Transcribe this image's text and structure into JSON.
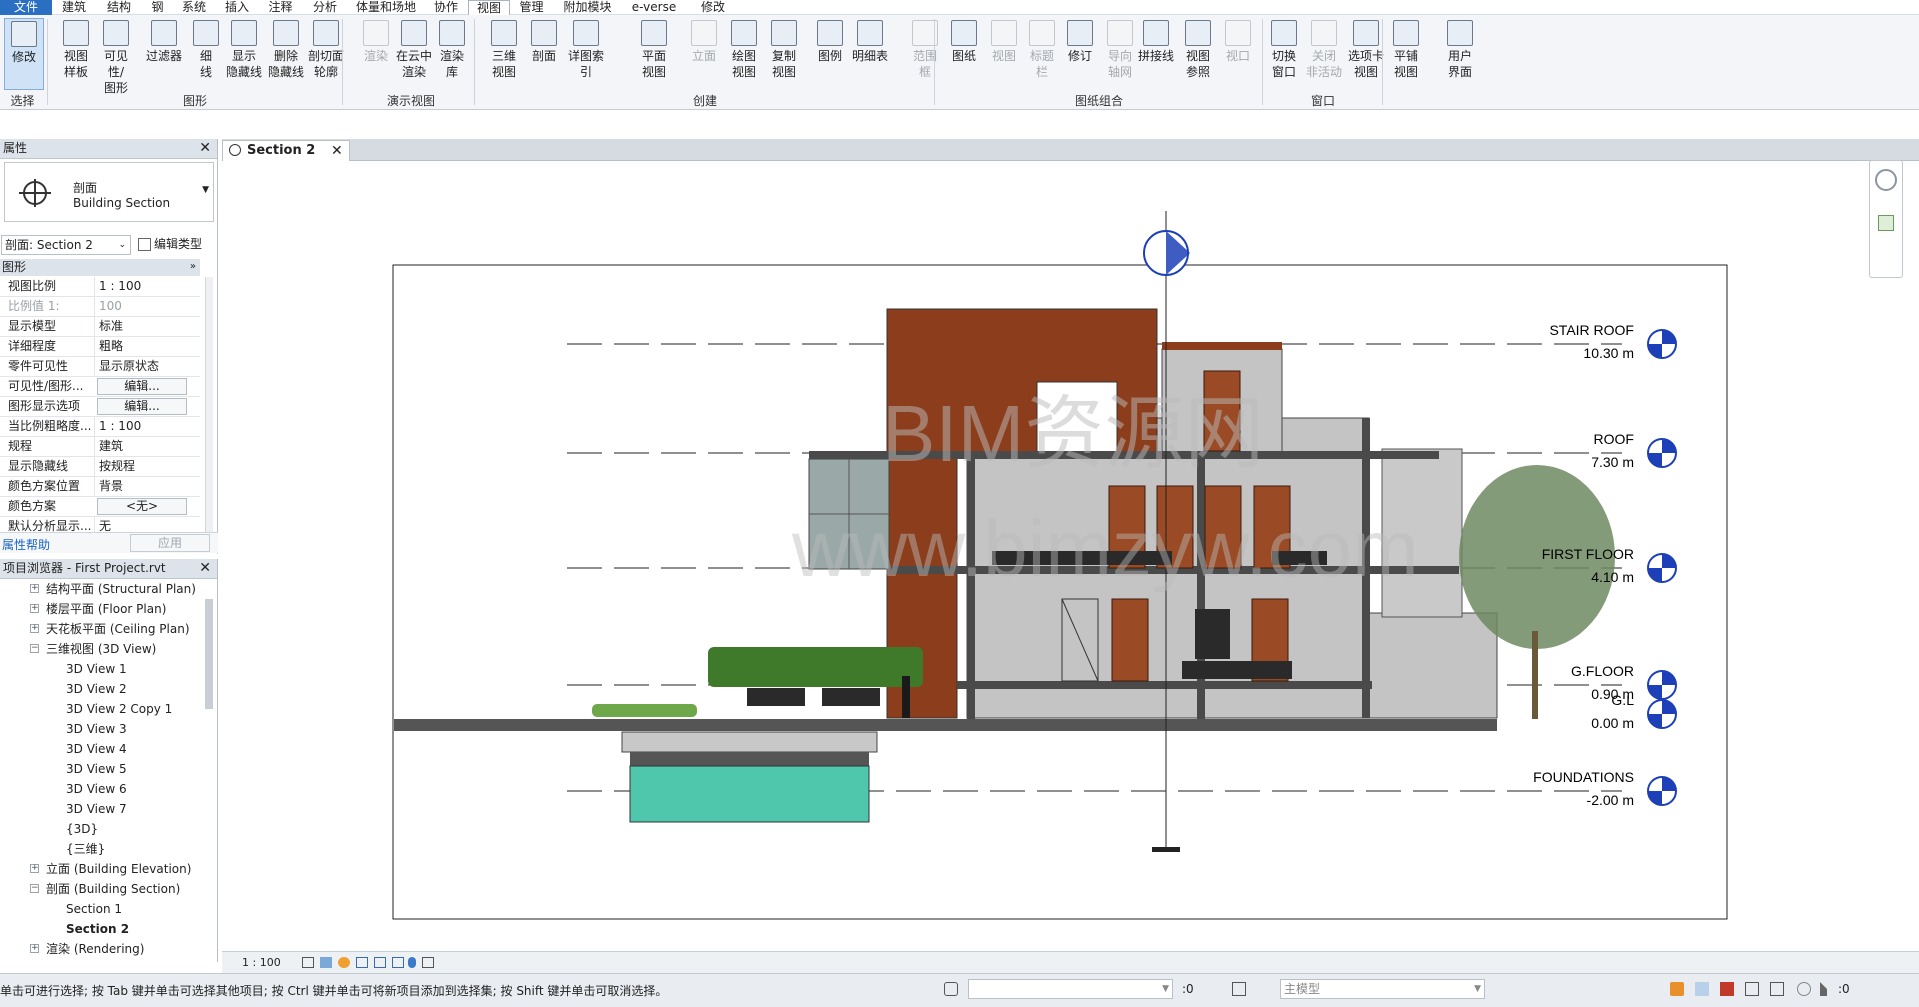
{
  "menu": {
    "tabs": [
      "文件",
      "建筑",
      "结构",
      "钢",
      "系统",
      "插入",
      "注释",
      "分析",
      "体量和场地",
      "协作",
      "视图",
      "管理",
      "附加模块",
      "e-verse",
      "修改"
    ],
    "active": "视图"
  },
  "ribbon": {
    "buttons": [
      {
        "l1": "修改",
        "l2": "",
        "state": "sel"
      },
      {
        "l1": "视图",
        "l2": "样板",
        "state": ""
      },
      {
        "l1": "可见性/",
        "l2": "图形",
        "state": ""
      },
      {
        "l1": "过滤器",
        "l2": "",
        "state": ""
      },
      {
        "l1": "细",
        "l2": "线",
        "state": ""
      },
      {
        "l1": "显示",
        "l2": "隐藏线",
        "state": ""
      },
      {
        "l1": "删除",
        "l2": "隐藏线",
        "state": ""
      },
      {
        "l1": "剖切面",
        "l2": "轮廓",
        "state": ""
      },
      {
        "l1": "渲染",
        "l2": "",
        "state": "off"
      },
      {
        "l1": "在云中",
        "l2": "渲染",
        "state": ""
      },
      {
        "l1": "渲染",
        "l2": "库",
        "state": ""
      },
      {
        "l1": "三维",
        "l2": "视图",
        "state": ""
      },
      {
        "l1": "剖面",
        "l2": "",
        "state": ""
      },
      {
        "l1": "详图索引",
        "l2": "",
        "state": ""
      },
      {
        "l1": "平面",
        "l2": "视图",
        "state": ""
      },
      {
        "l1": "立面",
        "l2": "",
        "state": "off"
      },
      {
        "l1": "绘图",
        "l2": "视图",
        "state": ""
      },
      {
        "l1": "复制",
        "l2": "视图",
        "state": ""
      },
      {
        "l1": "图例",
        "l2": "",
        "state": ""
      },
      {
        "l1": "明细表",
        "l2": "",
        "state": ""
      },
      {
        "l1": "范围",
        "l2": "框",
        "state": "off"
      },
      {
        "l1": "图纸",
        "l2": "",
        "state": ""
      },
      {
        "l1": "视图",
        "l2": "",
        "state": "off"
      },
      {
        "l1": "标题",
        "l2": "栏",
        "state": "off"
      },
      {
        "l1": "修订",
        "l2": "",
        "state": ""
      },
      {
        "l1": "导向",
        "l2": "轴网",
        "state": "off"
      },
      {
        "l1": "拼接线",
        "l2": "",
        "state": ""
      },
      {
        "l1": "视图",
        "l2": "参照",
        "state": ""
      },
      {
        "l1": "视口",
        "l2": "",
        "state": "off"
      },
      {
        "l1": "切换",
        "l2": "窗口",
        "state": ""
      },
      {
        "l1": "关闭",
        "l2": "非活动",
        "state": "off"
      },
      {
        "l1": "选项卡",
        "l2": "视图",
        "state": ""
      },
      {
        "l1": "平铺",
        "l2": "视图",
        "state": ""
      },
      {
        "l1": "用户",
        "l2": "界面",
        "state": ""
      }
    ],
    "groups": [
      "选择",
      "图形",
      "演示视图",
      "创建",
      "图纸组合",
      "窗口"
    ]
  },
  "document_tab": {
    "label": "Section 2",
    "close": "✕"
  },
  "properties": {
    "title": "属性",
    "close": "✕",
    "type_line1": "剖面",
    "type_line2": "Building Section",
    "selector": "剖面: Section 2",
    "edit_type": "编辑类型",
    "category": "图形",
    "rows": [
      {
        "k": "视图比例",
        "v": "1 : 100",
        "kind": "text"
      },
      {
        "k": "比例值 1:",
        "v": "100",
        "kind": "dim"
      },
      {
        "k": "显示模型",
        "v": "标准",
        "kind": "text"
      },
      {
        "k": "详细程度",
        "v": "粗略",
        "kind": "text"
      },
      {
        "k": "零件可见性",
        "v": "显示原状态",
        "kind": "text"
      },
      {
        "k": "可见性/图形...",
        "v": "编辑...",
        "kind": "btn"
      },
      {
        "k": "图形显示选项",
        "v": "编辑...",
        "kind": "btn"
      },
      {
        "k": "当比例粗略度...",
        "v": "1 : 100",
        "kind": "text"
      },
      {
        "k": "规程",
        "v": "建筑",
        "kind": "text"
      },
      {
        "k": "显示隐藏线",
        "v": "按规程",
        "kind": "text"
      },
      {
        "k": "颜色方案位置",
        "v": "背景",
        "kind": "text"
      },
      {
        "k": "颜色方案",
        "v": "<无>",
        "kind": "btn"
      },
      {
        "k": "默认分析显示...",
        "v": "无",
        "kind": "text"
      }
    ],
    "help": "属性帮助",
    "apply": "应用"
  },
  "browser": {
    "title": "项目浏览器 - First Project.rvt",
    "close": "✕",
    "nodes": [
      {
        "t": "结构平面 (Structural Plan)",
        "lvl": 1,
        "ex": "+"
      },
      {
        "t": "楼层平面 (Floor Plan)",
        "lvl": 1,
        "ex": "+"
      },
      {
        "t": "天花板平面 (Ceiling Plan)",
        "lvl": 1,
        "ex": "+"
      },
      {
        "t": "三维视图 (3D View)",
        "lvl": 1,
        "ex": "-"
      },
      {
        "t": "3D View 1",
        "lvl": 2,
        "ex": ""
      },
      {
        "t": "3D View 2",
        "lvl": 2,
        "ex": ""
      },
      {
        "t": "3D View 2 Copy 1",
        "lvl": 2,
        "ex": ""
      },
      {
        "t": "3D View 3",
        "lvl": 2,
        "ex": ""
      },
      {
        "t": "3D View 4",
        "lvl": 2,
        "ex": ""
      },
      {
        "t": "3D View 5",
        "lvl": 2,
        "ex": ""
      },
      {
        "t": "3D View 6",
        "lvl": 2,
        "ex": ""
      },
      {
        "t": "3D View 7",
        "lvl": 2,
        "ex": ""
      },
      {
        "t": "{3D}",
        "lvl": 2,
        "ex": ""
      },
      {
        "t": "{三维}",
        "lvl": 2,
        "ex": ""
      },
      {
        "t": "立面 (Building Elevation)",
        "lvl": 1,
        "ex": "+"
      },
      {
        "t": "剖面 (Building Section)",
        "lvl": 1,
        "ex": "-"
      },
      {
        "t": "Section 1",
        "lvl": 2,
        "ex": ""
      },
      {
        "t": "Section 2",
        "lvl": 2,
        "ex": "",
        "bold": true
      },
      {
        "t": "渲染 (Rendering)",
        "lvl": 1,
        "ex": "+"
      }
    ]
  },
  "drawing": {
    "levels": [
      {
        "name": "STAIR ROOF",
        "elev": "10.30 m"
      },
      {
        "name": "ROOF",
        "elev": "7.30 m"
      },
      {
        "name": "FIRST FLOOR",
        "elev": "4.10 m"
      },
      {
        "name": "G.FLOOR",
        "elev": "0.90 m"
      },
      {
        "name": "G.L",
        "elev": "0.00 m"
      },
      {
        "name": "FOUNDATIONS",
        "elev": "-2.00 m"
      }
    ],
    "watermark1": "BIM资源网",
    "watermark2": "www.bimzyw.com"
  },
  "viewbar": {
    "scale": "1 : 100"
  },
  "status": {
    "text": "单击可进行选择; 按 Tab 键并单击可选择其他项目; 按 Ctrl 键并单击可将新项目添加到选择集; 按 Shift 键并单击可取消选择。",
    "count1": ":0",
    "model": "主模型",
    "count2": ":0"
  },
  "colors": {
    "accent": "#2b6fc2",
    "brick": "#8b3d1c",
    "door": "#9a4a25",
    "concrete": "#c4c4c4",
    "pool": "#4ec7ad",
    "level": "#1d3fb8"
  }
}
